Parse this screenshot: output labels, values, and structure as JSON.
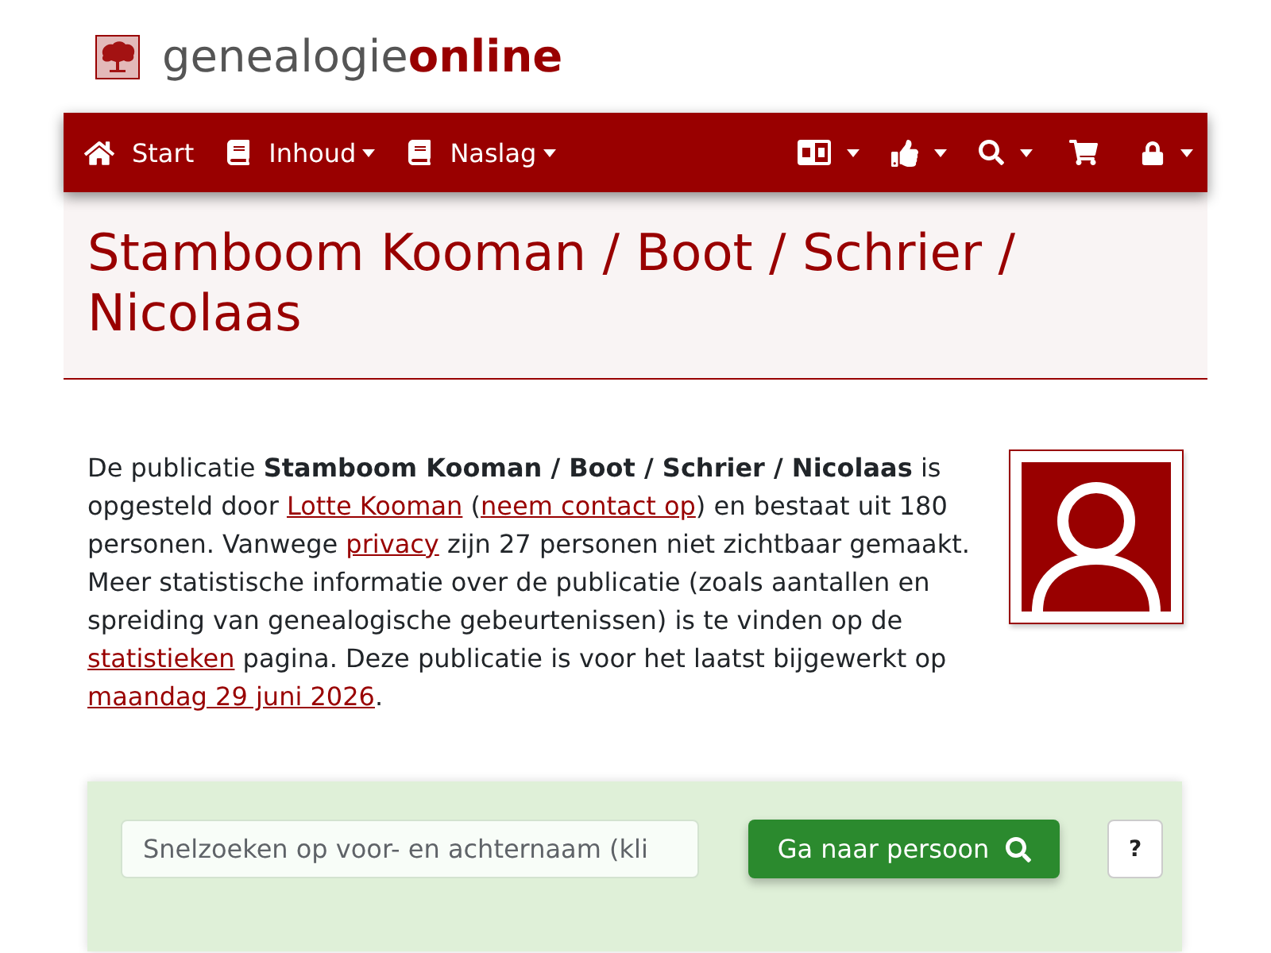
{
  "header": {
    "logo_text": "genealogie**online**"
  },
  "navbar": {
    "items": [
      {
        "label": "Start",
        "dropdown": false
      },
      {
        "label": "Inhoud",
        "dropdown": true
      },
      {
        "label": "Naslag",
        "dropdown": true
      }
    ],
    "tools": [
      {
        "dropdown": true
      },
      {
        "dropdown": true
      },
      {
        "dropdown": true
      },
      {
        "dropdown": false
      },
      {
        "dropdown": true
      }
    ]
  },
  "page_title": "Stamboom Kooman / Boot / Schrier / Nicolaas",
  "intro": [
    {
      "kind": "text",
      "text": "De publicatie **Stamboom Kooman / Boot / Schrier / Nicolaas** is opgesteld door "
    },
    {
      "kind": "link",
      "text": "Lotte Kooman"
    },
    {
      "kind": "text",
      "text": " ("
    },
    {
      "kind": "link",
      "text": "neem contact op"
    },
    {
      "kind": "text",
      "text": ") en bestaat uit 180 personen. Vanwege "
    },
    {
      "kind": "link",
      "text": "privacy"
    },
    {
      "kind": "text",
      "text": " zijn 27 personen niet zichtbaar gemaakt. Meer statistische informatie over de publicatie (zoals aantallen en spreiding van genealogische gebeurtenissen) is te vinden op de "
    },
    {
      "kind": "link",
      "text": "statistieken"
    },
    {
      "kind": "text",
      "text": " pagina. Deze publicatie is voor het laatst bijgewerkt op "
    },
    {
      "kind": "link",
      "text": "maandag 29 juni 2026"
    },
    {
      "kind": "text",
      "text": "."
    }
  ],
  "search": {
    "placeholder": "Snelzoeken op voor- en achternaam (kli",
    "button": "Ga naar persoon",
    "help": "?"
  }
}
